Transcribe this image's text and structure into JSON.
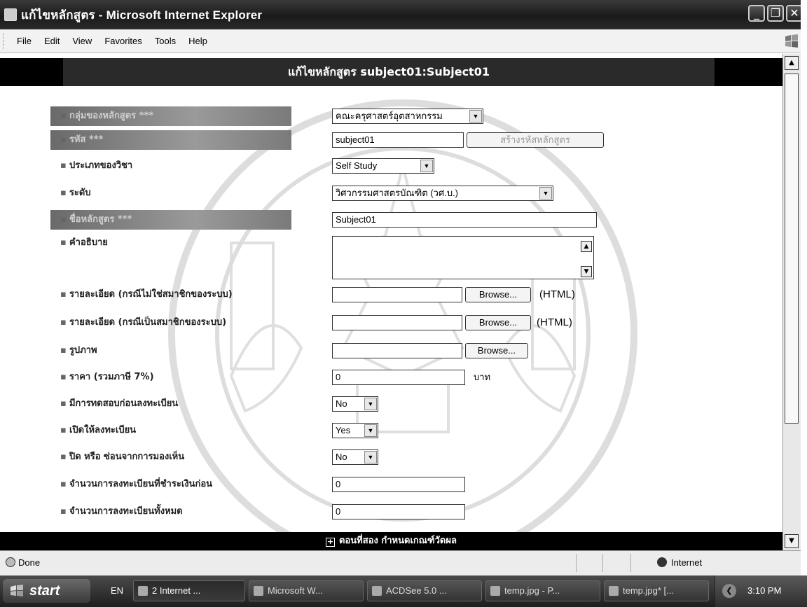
{
  "window": {
    "title": "แก้ไขหลักสูตร - Microsoft Internet Explorer",
    "controls": [
      "_",
      "❐",
      "✕"
    ]
  },
  "menubar": [
    "File",
    "Edit",
    "View",
    "Favorites",
    "Tools",
    "Help"
  ],
  "page": {
    "header": "แก้ไขหลักสูตร subject01:Subject01",
    "footer": "ตอนที่สอง กำหนดเกณฑ์วัดผล",
    "footer_icon": "+"
  },
  "form": {
    "group_label": "กลุ่มของหลักสูตร ***",
    "group_value": "คณะครุศาสตร์อุตสาหกรรม",
    "code_label": "รหัส ***",
    "code_value": "subject01",
    "code_button": "สร้างรหัสหลักสูตร",
    "type_label": "ประเภทของวิชา",
    "type_value": "Self Study",
    "level_label": "ระดับ",
    "level_value": "วิศวกรรมศาสตรบัณฑิต (วศ.บ.)",
    "name_label": "ชื่อหลักสูตร ***",
    "name_value": "Subject01",
    "desc_label": "คำอธิบาย",
    "detail_nonmember_label": "รายละเอียด (กรณีไม่ใช่สมาชิกของระบบ)",
    "detail_member_label": "รายละเอียด (กรณีเป็นสมาชิกของระบบ)",
    "browse_label": "Browse...",
    "html_suffix": "(HTML)",
    "image_label": "รูปภาพ",
    "price_label": "ราคา (รวมภาษี 7%)",
    "price_value": "0",
    "price_unit": "บาท",
    "pretest_label": "มีการทดสอบก่อนลงทะเบียน",
    "pretest_value": "No",
    "open_label": "เปิดให้ลงทะเบียน",
    "open_value": "Yes",
    "hide_label": "ปิด หรือ ซ่อนจากการมองเห็น",
    "hide_value": "No",
    "paid_count_label": "จำนวนการลงทะเบียนที่ชำระเงินก่อน",
    "paid_count_value": "0",
    "total_count_label": "จำนวนการลงทะเบียนทั้งหมด",
    "total_count_value": "0"
  },
  "statusbar": {
    "status": "Done",
    "zone": "Internet"
  },
  "taskbar": {
    "start": "start",
    "lang": "EN",
    "tasks": [
      "2 Internet ...",
      "Microsoft W...",
      "ACDSee 5.0 ...",
      "temp.jpg - P...",
      "temp.jpg* [..."
    ],
    "clock": "3:10 PM"
  }
}
